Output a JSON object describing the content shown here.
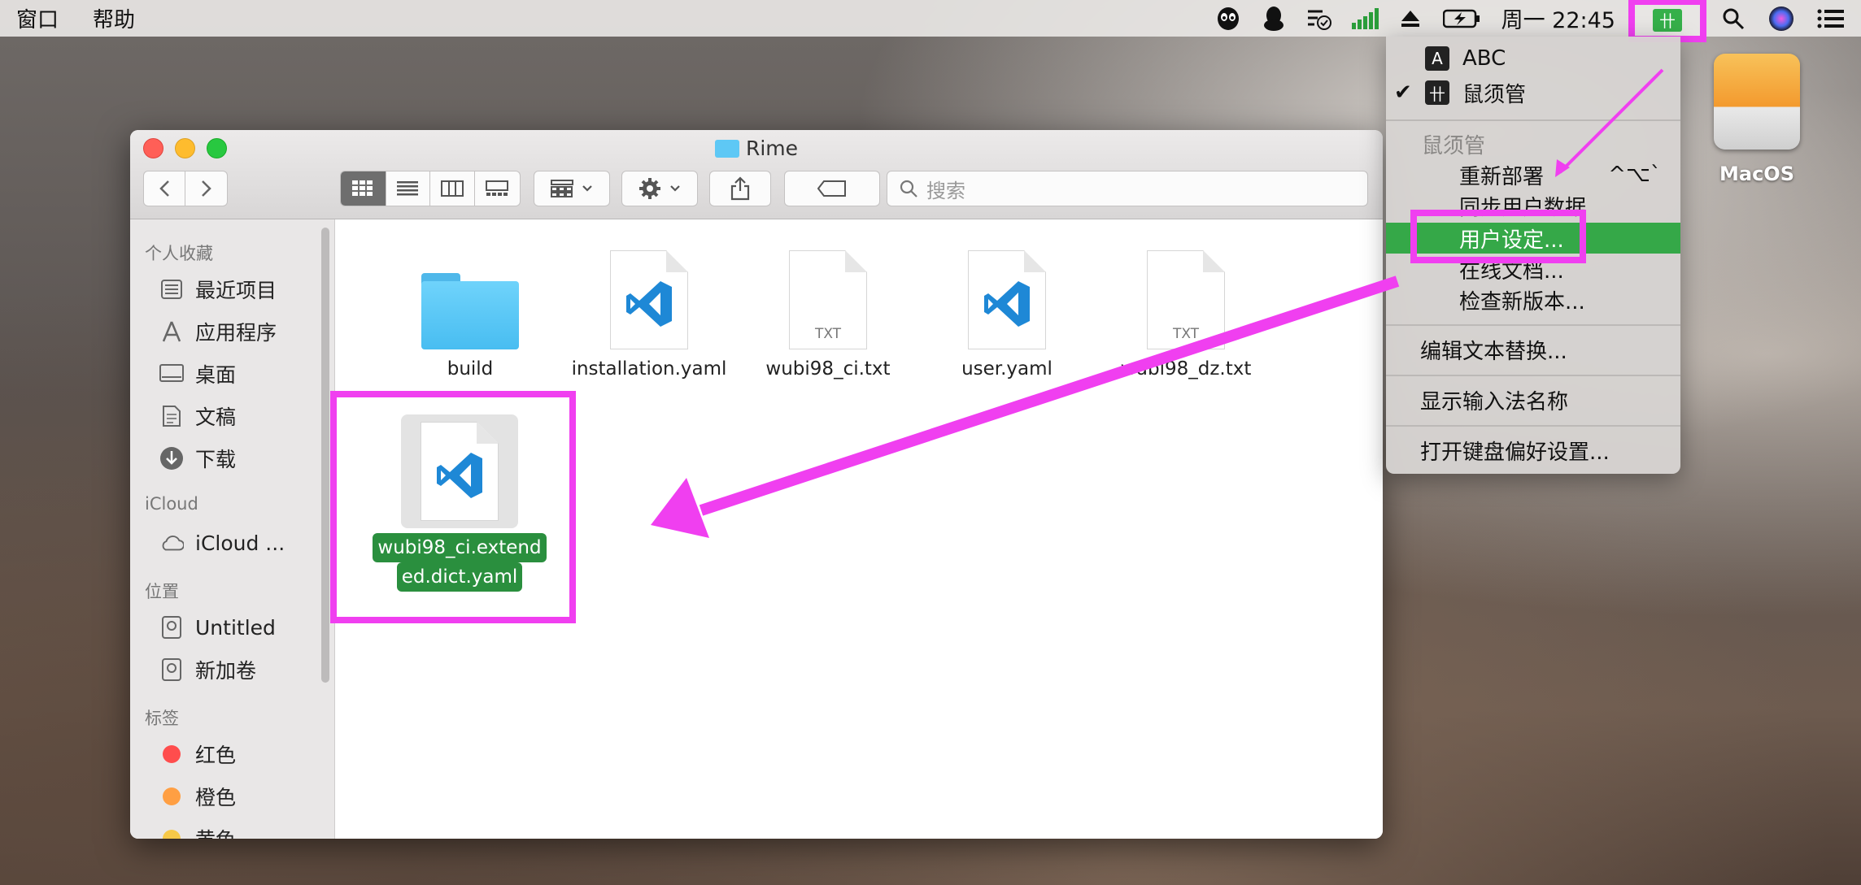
{
  "menubar": {
    "items": [
      "窗口",
      "帮助"
    ],
    "clock": "周一 22:45",
    "status_icons": [
      "alien-icon",
      "qq-penguin-icon",
      "checkmark-tool-icon",
      "signal-bars-icon",
      "eject-icon",
      "battery-charging-icon"
    ],
    "ime_badge": "卄"
  },
  "desktop": {
    "drive_label": "MacOS"
  },
  "finder": {
    "title": "Rime",
    "search_placeholder": "搜索",
    "sidebar": {
      "favorites_header": "个人收藏",
      "favorites": [
        "最近项目",
        "应用程序",
        "桌面",
        "文稿",
        "下载"
      ],
      "icloud_header": "iCloud",
      "icloud": [
        "iCloud ..."
      ],
      "locations_header": "位置",
      "locations": [
        "Untitled",
        "新加卷"
      ],
      "tags_header": "标签",
      "tags": [
        {
          "label": "红色",
          "color": "#ff4d4d"
        },
        {
          "label": "橙色",
          "color": "#ff9f43"
        },
        {
          "label": "黄色",
          "color": "#f7c948"
        }
      ]
    },
    "files": [
      {
        "name": "build",
        "kind": "folder"
      },
      {
        "name": "installation.yaml",
        "kind": "vscode"
      },
      {
        "name": "wubi98_ci.txt",
        "kind": "txt",
        "badge": "TXT"
      },
      {
        "name": "user.yaml",
        "kind": "vscode"
      },
      {
        "name": "wubi98_dz.txt",
        "kind": "txt",
        "badge": "TXT"
      },
      {
        "name_line1": "wubi98_ci.extend",
        "name_line2": "ed.dict.yaml",
        "kind": "vscode",
        "selected": true
      }
    ]
  },
  "ime_menu": {
    "input_sources": [
      {
        "badge": "A",
        "label": "ABC",
        "checked": false
      },
      {
        "badge": "卄",
        "label": "鼠须管",
        "checked": true
      }
    ],
    "section_title": "鼠须管",
    "section_items": [
      {
        "label": "重新部署",
        "shortcut": "^⌥`"
      },
      {
        "label": "同步用户数据"
      },
      {
        "label": "用户设定...",
        "highlighted": true
      },
      {
        "label": "在线文档..."
      },
      {
        "label": "检查新版本..."
      }
    ],
    "edit_text": "编辑文本替换...",
    "show_name": "显示输入法名称",
    "open_prefs": "打开键盘偏好设置..."
  },
  "colors": {
    "highlight": "#f03ff0",
    "menu_active": "#35a848",
    "selection_label": "#2a8f3e"
  }
}
